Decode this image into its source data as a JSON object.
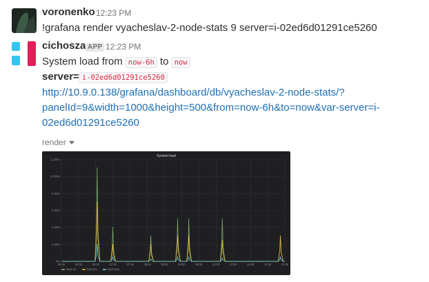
{
  "messages": [
    {
      "user": "voronenko",
      "time": "12:23 PM",
      "text": "!grafana render vyacheslav-2-node-stats 9 server=i-02ed6d01291ce5260"
    },
    {
      "user": "cichosza",
      "badge": "APP",
      "time": "12:23 PM",
      "line1_prefix": "System load from",
      "from_code": "now-6h",
      "line1_mid": "to",
      "to_code": "now",
      "server_label": "server=",
      "server_code": "i-02ed6d01291ce5260",
      "url_lines": [
        "http://10.9.0.138/grafana/dashboard/db/vyacheslav-2-node-stats/?",
        "panelId=9&width=1000&height=500&from=now-6h&to=now&var-server=i-",
        "02ed6d01291ce5260"
      ],
      "attachment_label": "render"
    }
  ],
  "colors": {
    "link": "#1d6fb8",
    "code_text": "#d72b3f",
    "chart_bg": "#1f1f22",
    "series_1m": "#7eb26d",
    "series_5m": "#eab839",
    "series_15m": "#6ed0e0"
  },
  "chart_data": {
    "type": "line",
    "title": "System load",
    "x": [
      "06:30",
      "06:45",
      "07:00",
      "07:15",
      "07:30",
      "07:45",
      "08:00",
      "08:15",
      "08:30",
      "08:45",
      "09:00",
      "09:15",
      "09:30",
      "09:45",
      "10:00",
      "10:15",
      "10:30",
      "10:45",
      "11:00",
      "11:15",
      "11:30",
      "11:45",
      "12:00",
      "12:15"
    ],
    "xticks": [
      "06:30",
      "06:00",
      "06:30",
      "07:00",
      "07:30",
      "08:00",
      "08:30",
      "09:00",
      "09:30",
      "10:00",
      "10:30",
      "11:00",
      "11:30",
      "12:00"
    ],
    "yticks": [
      "0%",
      "2.00%",
      "4.00%",
      "6.00%",
      "8.00%",
      "10.00%",
      "12.00%"
    ],
    "ylim": [
      0,
      12
    ],
    "series": [
      {
        "name": "load 1m",
        "color": "#7eb26d",
        "peaks": [
          [
            0.16,
            11.0
          ],
          [
            0.23,
            4.0
          ],
          [
            0.4,
            3.0
          ],
          [
            0.52,
            5.0
          ],
          [
            0.57,
            5.0
          ],
          [
            0.72,
            5.0
          ],
          [
            0.98,
            3.0
          ]
        ]
      },
      {
        "name": "load 5m",
        "color": "#eab839",
        "peaks": [
          [
            0.16,
            7.0
          ],
          [
            0.23,
            2.0
          ],
          [
            0.4,
            2.0
          ],
          [
            0.52,
            3.0
          ],
          [
            0.57,
            3.0
          ],
          [
            0.72,
            2.5
          ],
          [
            0.98,
            3.0
          ]
        ]
      },
      {
        "name": "load 15m",
        "color": "#6ed0e0",
        "peaks": [
          [
            0.16,
            2.0
          ],
          [
            0.23,
            0.5
          ],
          [
            0.4,
            0.3
          ],
          [
            0.52,
            0.5
          ],
          [
            0.57,
            0.5
          ],
          [
            0.72,
            0.4
          ],
          [
            0.98,
            0.5
          ]
        ]
      }
    ],
    "legend": [
      "load 1m",
      "load 5m",
      "load 15m"
    ],
    "legend_position": "bottom-left",
    "grid": true
  }
}
